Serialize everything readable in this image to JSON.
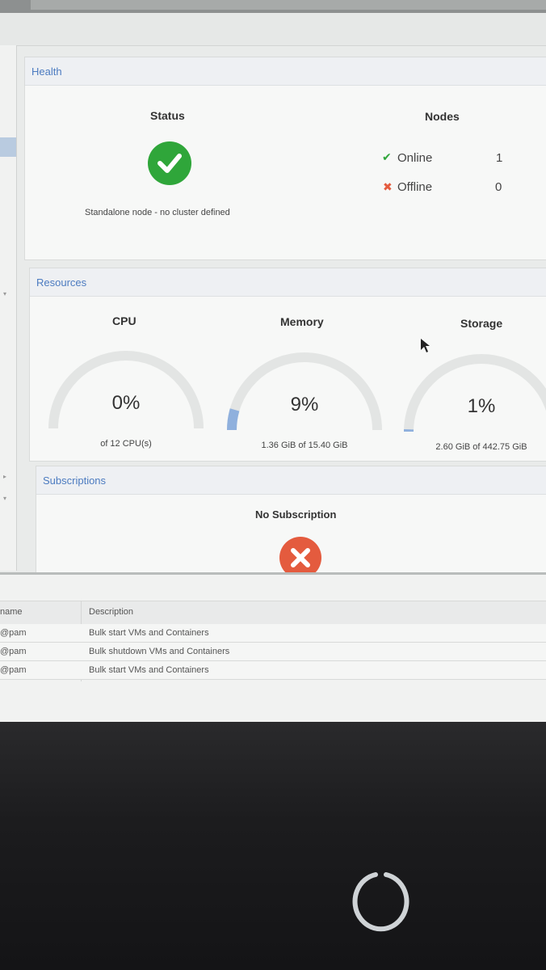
{
  "health": {
    "title": "Health",
    "status_label": "Status",
    "status_text": "Standalone node - no cluster defined",
    "nodes_label": "Nodes",
    "online_label": "Online",
    "online_count": "1",
    "offline_label": "Offline",
    "offline_count": "0",
    "status_icon": "check-circle-icon"
  },
  "resources": {
    "title": "Resources",
    "gauges": [
      {
        "label": "CPU",
        "percent": "0%",
        "value": 0,
        "detail": "of 12 CPU(s)"
      },
      {
        "label": "Memory",
        "percent": "9%",
        "value": 9,
        "detail": "1.36 GiB of 15.40 GiB"
      },
      {
        "label": "Storage",
        "percent": "1%",
        "value": 1,
        "detail": "2.60 GiB of 442.75 GiB"
      }
    ]
  },
  "subscriptions": {
    "title": "Subscriptions",
    "status": "No Subscription",
    "icon": "error-circle-icon"
  },
  "tasks": {
    "columns": [
      "name",
      "Description"
    ],
    "rows": [
      {
        "user": "@pam",
        "description": "Bulk start VMs and Containers"
      },
      {
        "user": "@pam",
        "description": "Bulk shutdown VMs and Containers"
      },
      {
        "user": "@pam",
        "description": "Bulk start VMs and Containers"
      }
    ]
  },
  "colors": {
    "ok": "#2fa63a",
    "error": "#e45b3e",
    "accent": "#4c7bc0",
    "gauge_fill": "#8fb0dd"
  }
}
